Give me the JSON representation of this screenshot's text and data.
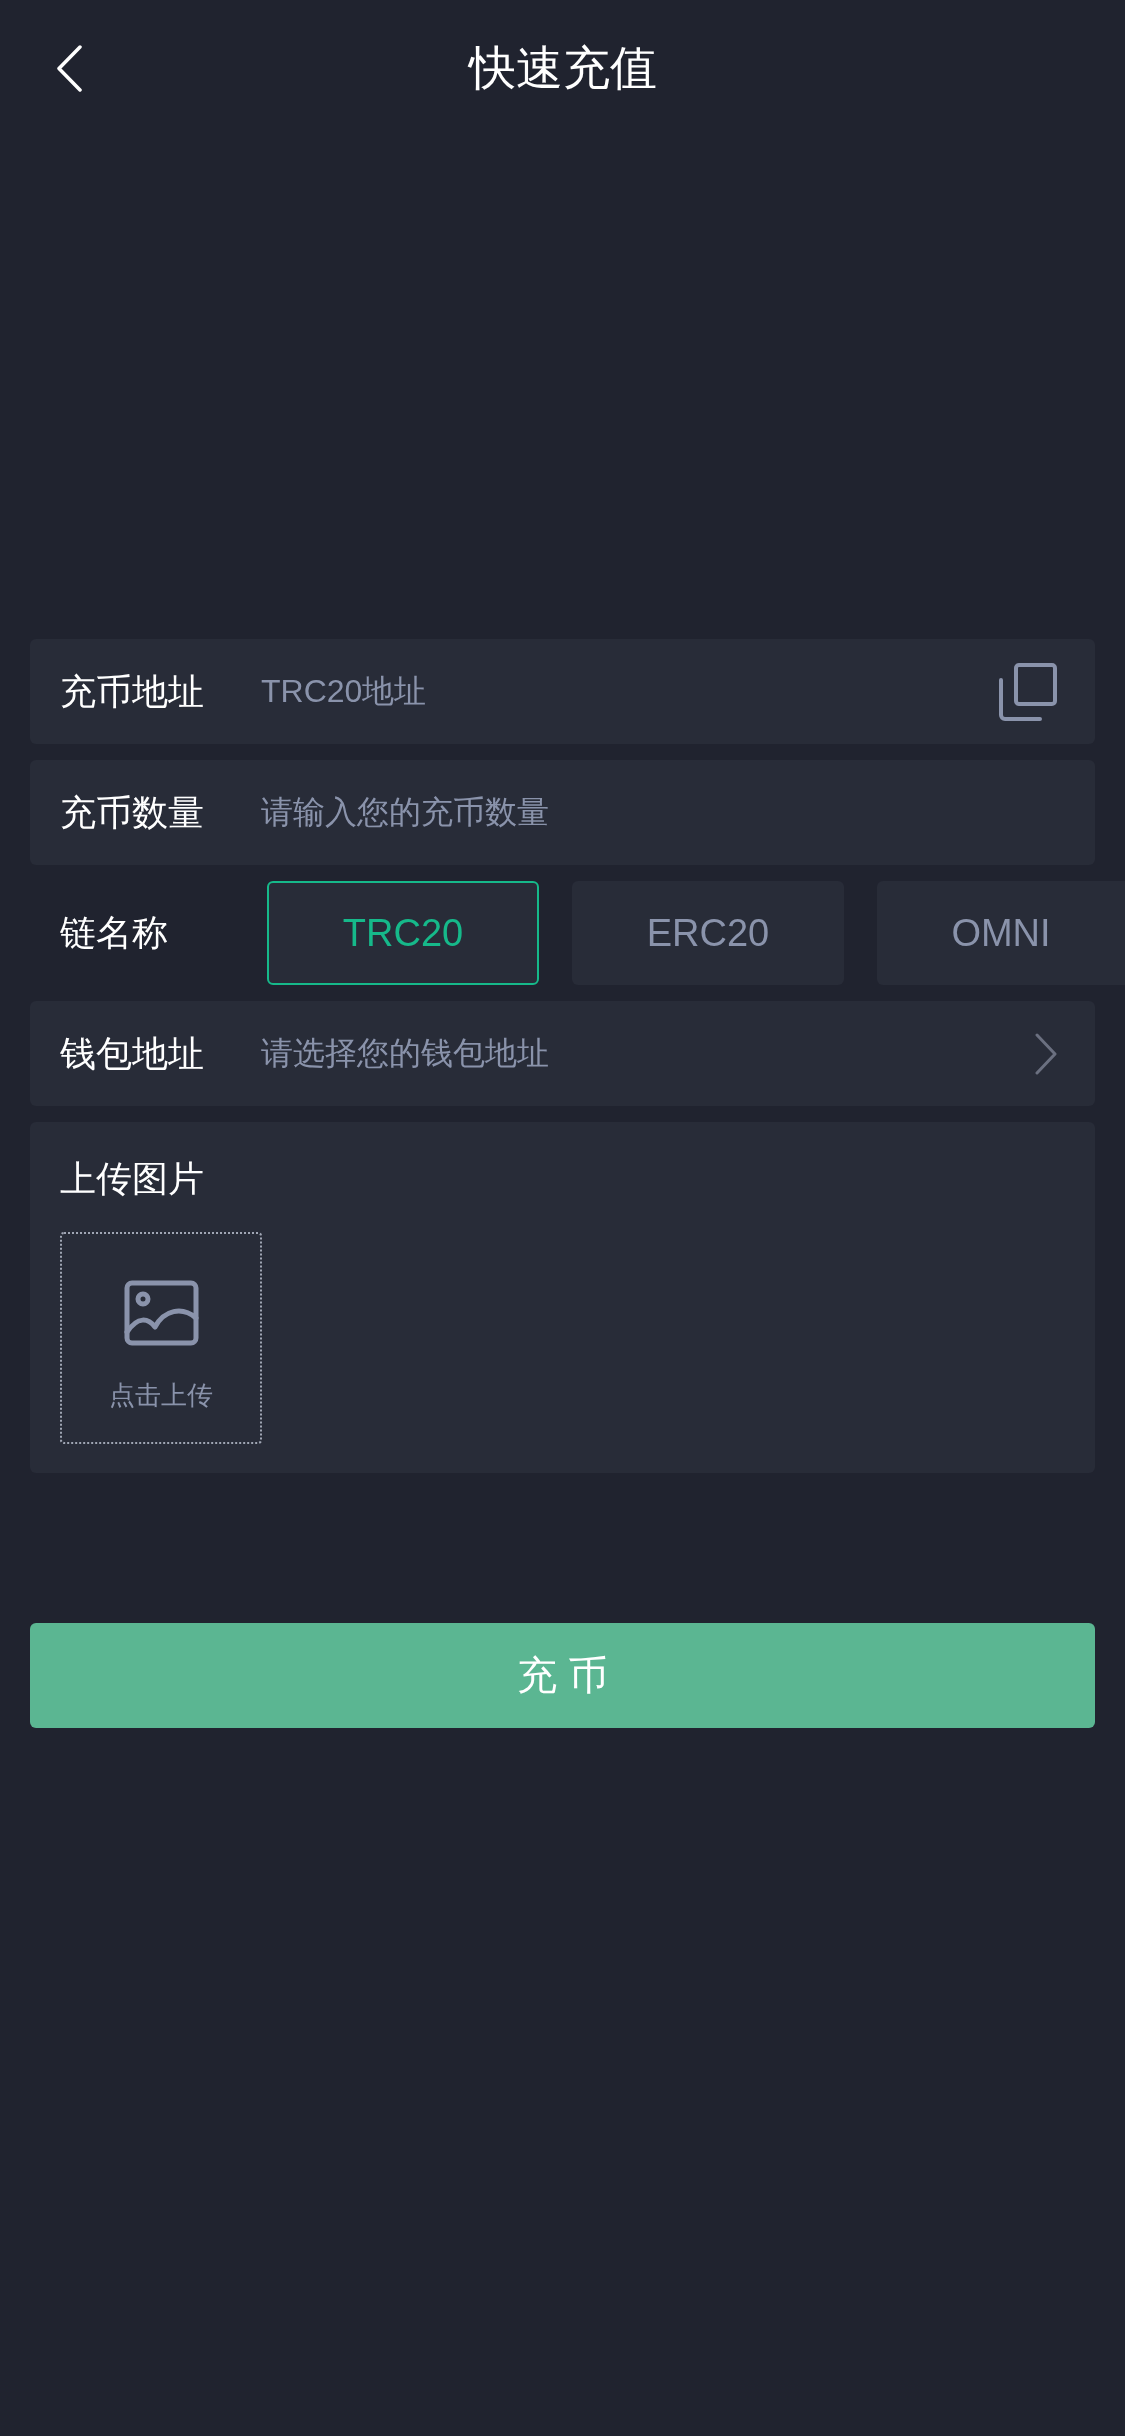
{
  "header": {
    "title": "快速充值"
  },
  "fields": [
    {
      "kind": "copy",
      "label": "充币地址",
      "placeholder": "TRC20地址"
    },
    {
      "kind": "input",
      "label": "充币数量",
      "placeholder": "请输入您的充币数量"
    },
    {
      "kind": "chain",
      "label": "链名称",
      "options": [
        {
          "label": "TRC20",
          "selected": true
        },
        {
          "label": "ERC20",
          "selected": false
        },
        {
          "label": "OMNI",
          "selected": false
        }
      ]
    },
    {
      "kind": "select",
      "label": "钱包地址",
      "placeholder": "请选择您的钱包地址"
    },
    {
      "kind": "upload",
      "label": "上传图片",
      "hint": "点击上传"
    }
  ],
  "submit": {
    "label": "充 币"
  }
}
